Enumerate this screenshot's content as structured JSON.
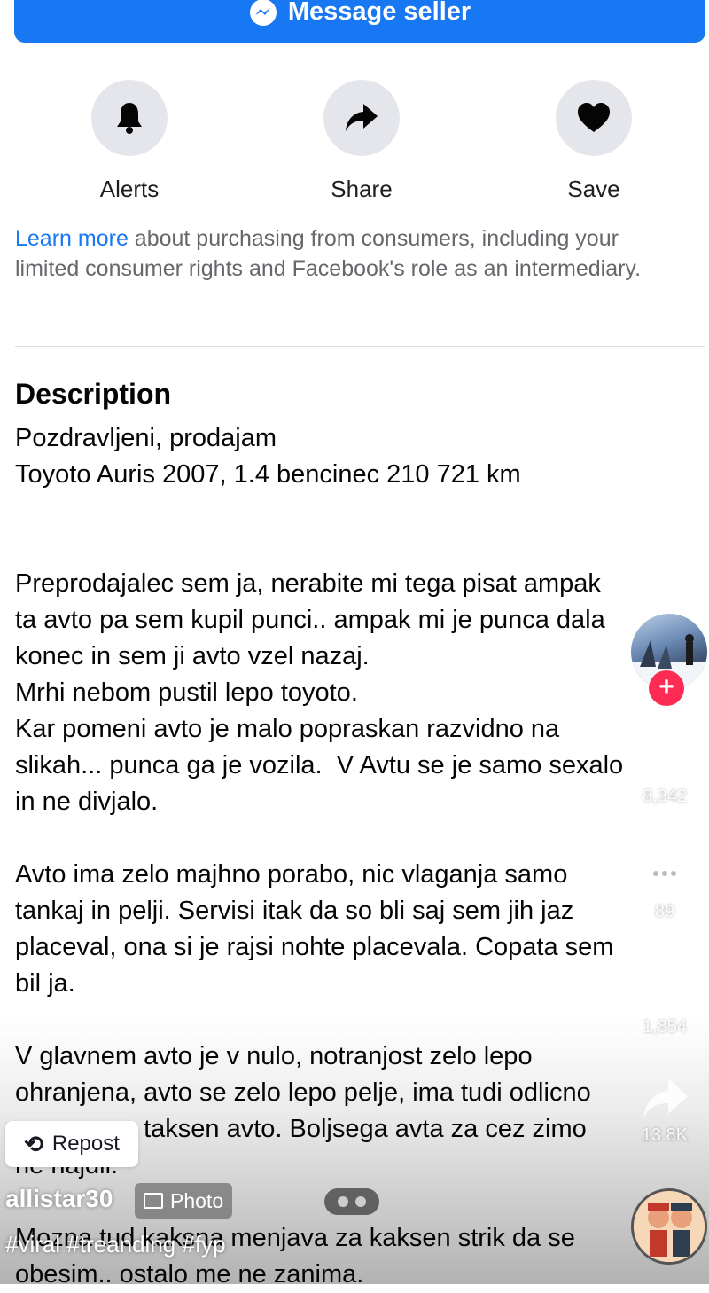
{
  "message_button": {
    "label": "Message seller"
  },
  "actions": [
    {
      "label": "Alerts",
      "icon": "bell-icon"
    },
    {
      "label": "Share",
      "icon": "share-arrow-icon"
    },
    {
      "label": "Save",
      "icon": "heart-icon"
    }
  ],
  "legal": {
    "link": "Learn more",
    "text": " about purchasing from consumers, including your limited consumer rights and Facebook's role as an intermediary."
  },
  "description": {
    "title": "Description",
    "body": "Pozdravljeni, prodajam\nToyoto Auris 2007, 1.4 bencinec 210 721 km\n\n\nPreprodajalec sem ja, nerabite mi tega pisat ampak\nta avto pa sem kupil punci.. ampak mi je punca dala\nkonec in sem ji avto vzel nazaj.\nMrhi nebom pustil lepo toyoto.\nKar pomeni avto je malo popraskan razvidno na\nslikah... punca ga je vozila.  V Avtu se je samo sexalo\nin ne divjalo.\n\nAvto ima zelo majhno porabo, nic vlaganja samo\ntankaj in pelji. Servisi itak da so bli saj sem jih jaz\nplaceval, ona si je rajsi nohte placevala. Copata sem\nbil ja.\n\nV glavnem avto je v nulo, notranjost zelo lepo\nohranjena, avto se zelo lepo pelje, ima tudi odlicno\nopremo za taksen avto. Boljsega avta za cez zimo\nne najdli.\n\nMozna tud kaksna menjava za kaksen strik da se\nobesim.. ostalo me ne zanima."
  },
  "overlay": {
    "likes": "8,342",
    "comments": "89",
    "saves": "1,854",
    "shares": "13.8K",
    "repost_label": "Repost",
    "username": "allistar30",
    "badge": "Photo",
    "hashtags": "#viral #treanding #fyp",
    "follow_symbol": "+"
  }
}
